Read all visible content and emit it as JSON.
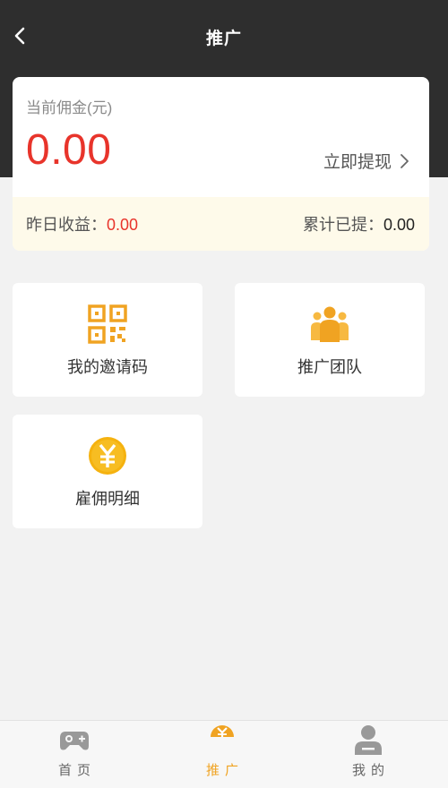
{
  "header": {
    "title": "推广"
  },
  "commission": {
    "label": "当前佣金(元)",
    "amount": "0.00",
    "withdraw_label": "立即提现",
    "yesterday_label": "昨日收益：",
    "yesterday_value": "0.00",
    "total_label": "累计已提：",
    "total_value": "0.00"
  },
  "grid": [
    {
      "label": "我的邀请码",
      "icon": "qr-code-icon"
    },
    {
      "label": "推广团队",
      "icon": "team-icon"
    },
    {
      "label": "雇佣明细",
      "icon": "yen-coin-icon"
    }
  ],
  "tabbar": [
    {
      "label": "首页",
      "icon": "gamepad-icon"
    },
    {
      "label": "推广",
      "icon": "promote-icon",
      "active": true
    },
    {
      "label": "我的",
      "icon": "user-icon"
    }
  ],
  "colors": {
    "header_bg": "#2e2e2e",
    "accent_red": "#e8342b",
    "accent_orange": "#f0a322",
    "highlight_bg": "#fefaea"
  }
}
